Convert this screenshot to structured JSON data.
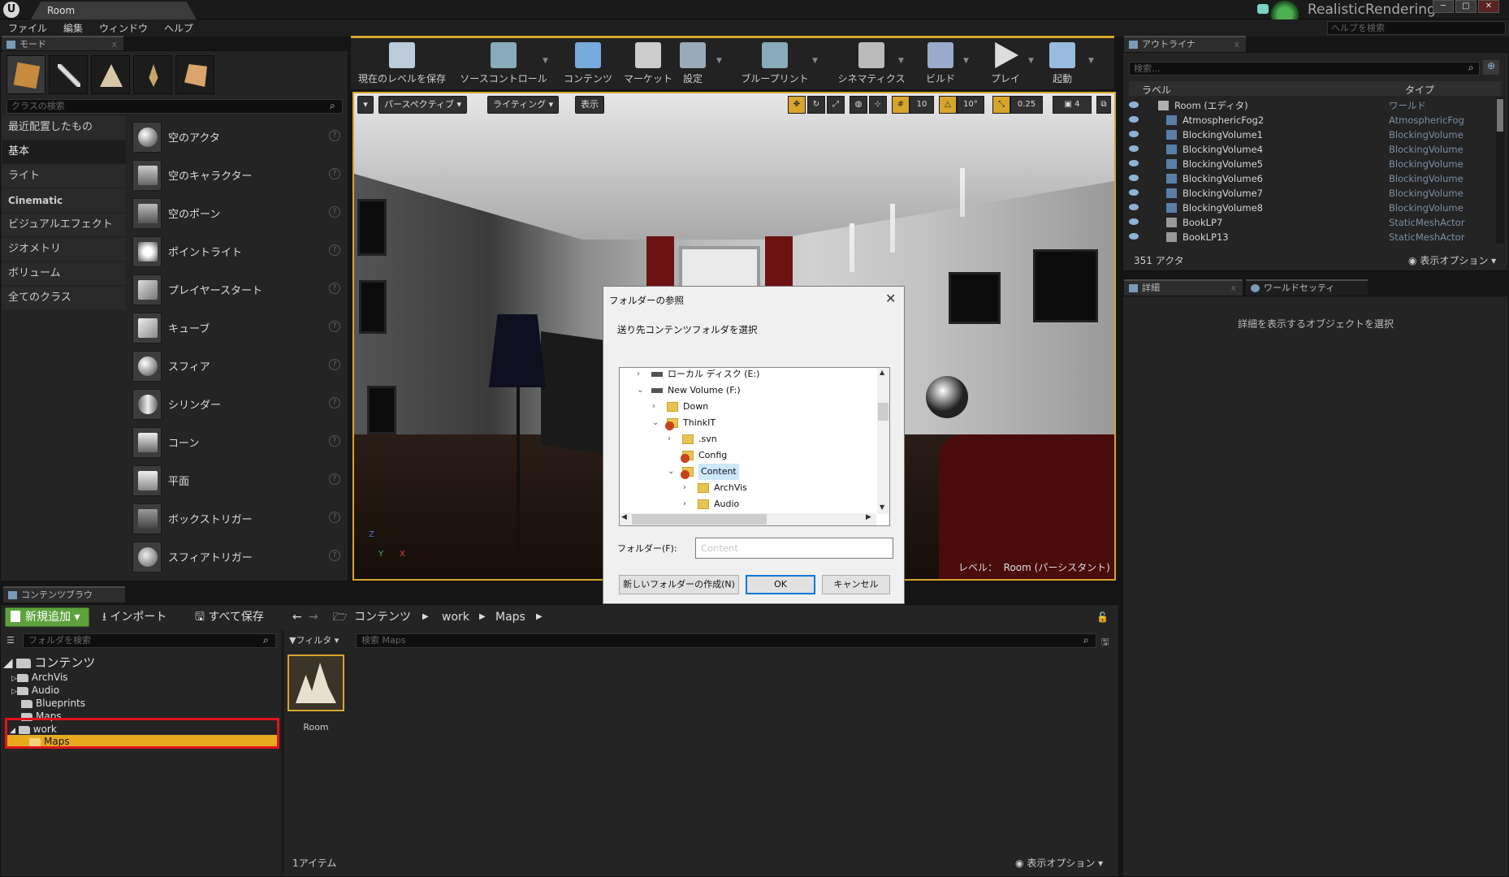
{
  "window": {
    "tab_title": "Room",
    "project_name": "RealisticRendering",
    "help_search_placeholder": "ヘルプを検索",
    "min": "─",
    "max": "□",
    "close": "✕"
  },
  "menu": [
    "ファイル",
    "編集",
    "ウィンドウ",
    "ヘルプ"
  ],
  "modes": {
    "tab_label": "モード",
    "class_search_placeholder": "クラスの検索",
    "categories": [
      "最近配置したもの",
      "基本",
      "ライト",
      "Cinematic",
      "ビジュアルエフェクト",
      "ジオメトリ",
      "ボリューム",
      "全てのクラス"
    ],
    "selected_category": "基本",
    "actors": [
      "空のアクタ",
      "空のキャラクター",
      "空のポーン",
      "ポイントライト",
      "プレイヤースタート",
      "キューブ",
      "スフィア",
      "シリンダー",
      "コーン",
      "平面",
      "ボックストリガー",
      "スフィアトリガー"
    ],
    "help_glyph": "?"
  },
  "toolbar": {
    "items": [
      "現在のレベルを保存",
      "ソースコントロール",
      "コンテンツ",
      "マーケット",
      "設定",
      "ブループリント",
      "シネマティクス",
      "ビルド",
      "プレイ",
      "起動"
    ]
  },
  "viewport": {
    "perspective": "パースペクティブ",
    "lighting": "ライティング",
    "show": "表示",
    "grid_snap": "10",
    "rot_snap": "10°",
    "scale_snap": "0.25",
    "cam_speed": "4",
    "level_prefix": "レベル：",
    "level_name": "Room (パーシスタント)",
    "axis": {
      "z": "Z",
      "y": "Y",
      "x": "X"
    }
  },
  "outliner": {
    "tab_label": "アウトライナ",
    "search_placeholder": "検索...",
    "col_label": "ラベル",
    "col_type": "タイプ",
    "rows": [
      {
        "name": "Room (エディタ)",
        "type": "ワールド"
      },
      {
        "name": "AtmosphericFog2",
        "type": "AtmosphericFog"
      },
      {
        "name": "BlockingVolume1",
        "type": "BlockingVolume"
      },
      {
        "name": "BlockingVolume4",
        "type": "BlockingVolume"
      },
      {
        "name": "BlockingVolume5",
        "type": "BlockingVolume"
      },
      {
        "name": "BlockingVolume6",
        "type": "BlockingVolume"
      },
      {
        "name": "BlockingVolume7",
        "type": "BlockingVolume"
      },
      {
        "name": "BlockingVolume8",
        "type": "BlockingVolume"
      },
      {
        "name": "BookLP7",
        "type": "StaticMeshActor"
      },
      {
        "name": "BookLP13",
        "type": "StaticMeshActor"
      }
    ],
    "actor_count": "351 アクタ",
    "view_options": "表示オプション"
  },
  "details": {
    "tab_label": "詳細",
    "world_tab_label": "ワールドセッティ",
    "empty_message": "詳細を表示するオブジェクトを選択"
  },
  "content_browser": {
    "tab_label": "コンテンツブラウ",
    "add_new": "新規追加",
    "import": "インポート",
    "save_all": "すべて保存",
    "breadcrumb": [
      "コンテンツ",
      "work",
      "Maps"
    ],
    "folder_search_placeholder": "フォルダを検索",
    "filter_label": "フィルタ",
    "asset_search_placeholder": "検索 Maps",
    "tree": {
      "root": "コンテンツ",
      "children": [
        "ArchVis",
        "Audio",
        "Blueprints",
        "Maps",
        "work"
      ],
      "work_child": "Maps"
    },
    "asset_name": "Room",
    "item_count": "1アイテム",
    "view_options": "表示オプション"
  },
  "dialog": {
    "title": "フォルダーの参照",
    "subtitle": "送り先コンテンツフォルダを選択",
    "tree": [
      {
        "label": "ローカル ディスク (E:)",
        "icon": "drive-icon",
        "indent": 1,
        "chev": ">"
      },
      {
        "label": "New Volume (F:)",
        "icon": "drive-icon",
        "indent": 1,
        "chev": "v"
      },
      {
        "label": "Down",
        "icon": "folder-icon",
        "indent": 2,
        "chev": ">"
      },
      {
        "label": "ThinkIT",
        "icon": "svn-folder-icon",
        "indent": 2,
        "chev": "v"
      },
      {
        "label": ".svn",
        "icon": "folder-icon",
        "indent": 3,
        "chev": ">"
      },
      {
        "label": "Config",
        "icon": "svn-folder-icon",
        "indent": 3,
        "chev": ""
      },
      {
        "label": "Content",
        "icon": "svn-folder-icon",
        "indent": 3,
        "chev": "v",
        "selected": true
      },
      {
        "label": "ArchVis",
        "icon": "folder-icon",
        "indent": 4,
        "chev": ">"
      },
      {
        "label": "Audio",
        "icon": "folder-icon",
        "indent": 4,
        "chev": ">"
      }
    ],
    "folder_label": "フォルダー(F):",
    "folder_value": "Content",
    "new_folder_button": "新しいフォルダーの作成(N)",
    "ok_button": "OK",
    "cancel_button": "キャンセル"
  },
  "colors": {
    "accent": "#d7a52c",
    "add_new_green": "#5da13d",
    "highlight_red": "#e0141c",
    "selected_folder": "#e7a91e"
  }
}
